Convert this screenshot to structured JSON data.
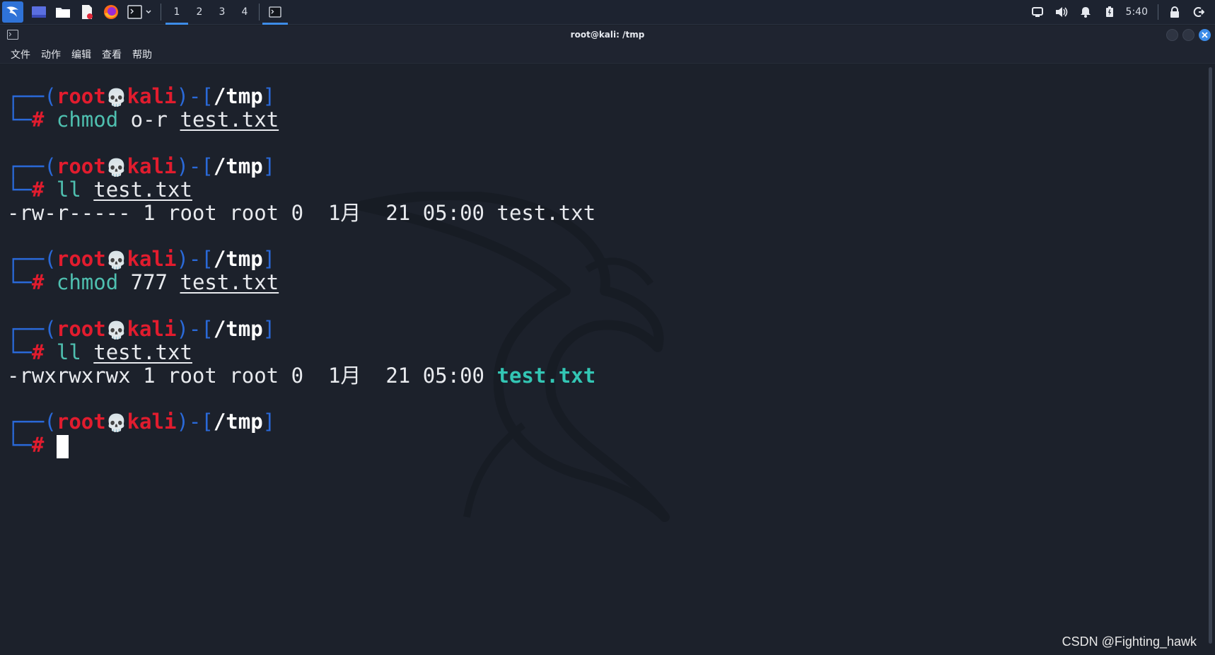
{
  "taskbar": {
    "workspaces": [
      "1",
      "2",
      "3",
      "4"
    ],
    "active_workspace": "1",
    "clock": "5:40"
  },
  "window": {
    "title": "root@kali: /tmp",
    "menu": [
      "文件",
      "动作",
      "编辑",
      "查看",
      "帮助"
    ]
  },
  "prompt": {
    "user": "root",
    "host": "kali",
    "dir": "/tmp",
    "symbol": "#",
    "skull": "💀"
  },
  "session": {
    "b1": {
      "cmd": "chmod",
      "arg": "o-r",
      "file": "test.txt"
    },
    "b2": {
      "cmd": "ll",
      "file": "test.txt",
      "out_perm": "-rw-r-----",
      "out_meta": " 1 root root 0  1月  21 05:00 ",
      "out_file": "test.txt"
    },
    "b3": {
      "cmd": "chmod",
      "arg": "777",
      "file": "test.txt"
    },
    "b4": {
      "cmd": "ll",
      "file": "test.txt",
      "out_perm": "-rwxrwxrwx",
      "out_meta": " 1 root root 0  1月  21 05:00 ",
      "out_file": "test.txt"
    }
  },
  "watermark": "CSDN @Fighting_hawk"
}
